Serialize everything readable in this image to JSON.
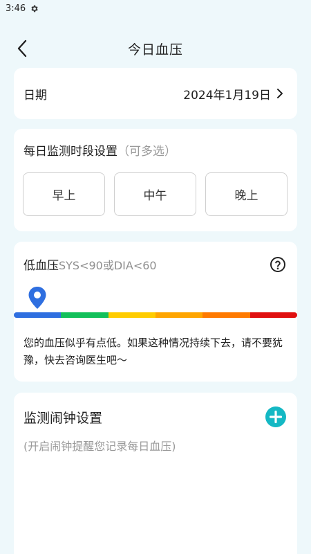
{
  "status_bar": {
    "time": "3:46",
    "settings_icon": "gear-icon"
  },
  "nav": {
    "title": "今日血压",
    "back_icon": "chevron-left-icon"
  },
  "date_card": {
    "label": "日期",
    "value": "2024年1月19日",
    "chevron_icon": "chevron-right-icon"
  },
  "period_card": {
    "heading": "每日监测时段设置",
    "hint": "（可多选）",
    "options": [
      "早上",
      "中午",
      "晚上"
    ]
  },
  "bp_card": {
    "title": "低血压",
    "condition": "SYS<90或DIA<60",
    "help_icon": "question-circle-icon",
    "pin_icon": "location-pin-icon",
    "message": "您的血压似乎有点低。如果这种情况持续下去，请不要犹豫，快去咨询医生吧～",
    "scale_colors": [
      "#2f6fe0",
      "#12c05a",
      "#ffcc00",
      "#ffa500",
      "#ff7a00",
      "#e01010"
    ],
    "pin_color": "#2f6fe0"
  },
  "alarm_card": {
    "title": "监测闹钟设置",
    "hint": "(开启闹钟提醒您记录每日血压)",
    "add_icon": "plus-circle-icon",
    "accent": "#14b8c4"
  }
}
